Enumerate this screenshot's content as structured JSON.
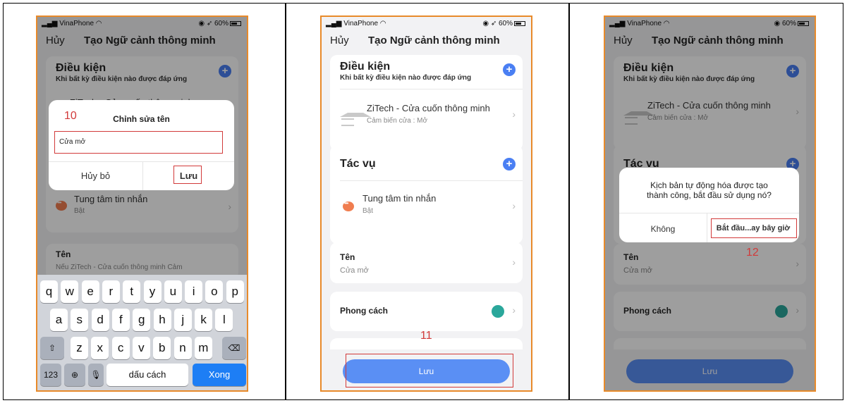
{
  "status": {
    "carrier": "VinaPhone",
    "battery": "60%"
  },
  "nav": {
    "cancel": "Hủy",
    "title": "Tạo Ngữ cảnh thông minh"
  },
  "conditions": {
    "title": "Điều kiện",
    "subtitle": "Khi bất kỳ điều kiện nào được đáp ứng",
    "device_name": "ZiTech - Cửa cuốn thông minh",
    "device_state": "Cảm biến cửa : Mở"
  },
  "tasks": {
    "title": "Tác vụ",
    "action_name": "Tung tâm tin nhắn",
    "action_state": "Bật"
  },
  "name_section": {
    "label": "Tên",
    "value": "Cửa mở",
    "preview": "Nếu ZiTech - Cửa cuốn thông minh Cảm"
  },
  "style_section": {
    "label": "Phong cách",
    "color": "#2aa79b"
  },
  "save_label": "Lưu",
  "edit_dialog": {
    "title": "Chỉnh sửa tên",
    "input_value": "Cửa mở",
    "cancel": "Hủy bỏ",
    "save": "Lưu"
  },
  "confirm_dialog": {
    "message_line1": "Kịch bản tự động hóa được tạo",
    "message_line2": "thành công, bắt đầu sử dụng nó?",
    "no": "Không",
    "yes": "Bắt đầu...ay bây giờ"
  },
  "keyboard": {
    "row1": [
      "q",
      "w",
      "e",
      "r",
      "t",
      "y",
      "u",
      "i",
      "o",
      "p"
    ],
    "row2": [
      "a",
      "s",
      "d",
      "f",
      "g",
      "h",
      "j",
      "k",
      "l"
    ],
    "row3": [
      "z",
      "x",
      "c",
      "v",
      "b",
      "n",
      "m"
    ],
    "numbers": "123",
    "space": "dấu cách",
    "done": "Xong"
  },
  "annotations": {
    "step10": "10",
    "step11": "11",
    "step12": "12"
  },
  "colors": {
    "accent": "#4a7ff3",
    "annotation": "#d23a3a",
    "phone_border": "#e88a2a"
  }
}
